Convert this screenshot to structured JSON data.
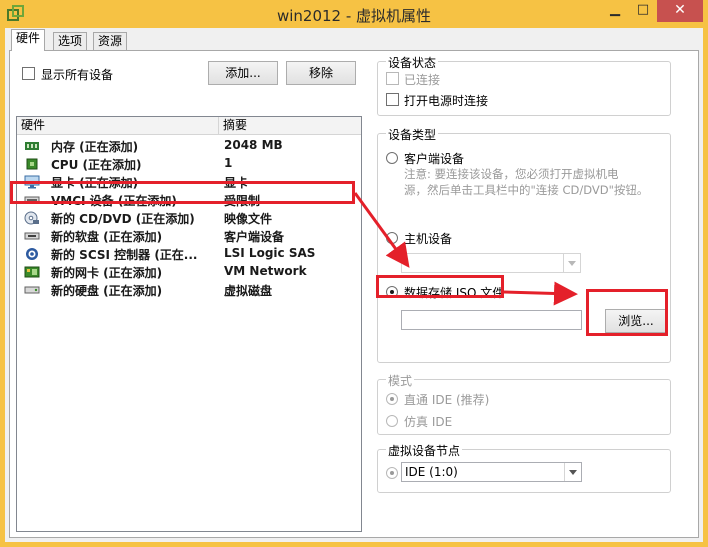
{
  "window": {
    "title": "win2012 - 虚拟机属性",
    "minimize_glyph": "▁",
    "maximize_glyph": "□",
    "close_glyph": "✕"
  },
  "tabs": [
    {
      "label": "硬件",
      "active": true
    },
    {
      "label": "选项",
      "active": false
    },
    {
      "label": "资源",
      "active": false
    }
  ],
  "hardware": {
    "show_all_label": "显示所有设备",
    "add_label": "添加...",
    "remove_label": "移除",
    "columns": [
      "硬件",
      "摘要"
    ],
    "rows": [
      {
        "name": "内存 (正在添加)",
        "summary": "2048 MB",
        "icon": "memory-icon"
      },
      {
        "name": "CPU (正在添加)",
        "summary": "1",
        "icon": "cpu-icon"
      },
      {
        "name": "显卡 (正在添加)",
        "summary": "显卡",
        "icon": "display-icon"
      },
      {
        "name": "VMCI 设备 (正在添加)",
        "summary": "受限制",
        "icon": "vmci-icon"
      },
      {
        "name": "新的 CD/DVD (正在添加)",
        "summary": "映像文件",
        "icon": "cd-dvd-icon"
      },
      {
        "name": "新的软盘 (正在添加)",
        "summary": "客户端设备",
        "icon": "floppy-icon"
      },
      {
        "name": "新的 SCSI 控制器 (正在...",
        "summary": "LSI Logic SAS",
        "icon": "scsi-icon"
      },
      {
        "name": "新的网卡 (正在添加)",
        "summary": "VM Network",
        "icon": "nic-icon"
      },
      {
        "name": "新的硬盘 (正在添加)",
        "summary": "虚拟磁盘",
        "icon": "disk-icon"
      }
    ]
  },
  "device_status": {
    "title": "设备状态",
    "connected_label": "已连接",
    "connect_on_power_label": "打开电源时连接"
  },
  "device_type": {
    "title": "设备类型",
    "client_device_label": "客户端设备",
    "client_note": "注意: 要连接该设备，您必须打开虚拟机电源，然后单击工具栏中的\"连接 CD/DVD\"按钮。",
    "client_note_line1": "注意: 要连接该设备，您必须打开虚拟机电",
    "client_note_line2": "源，然后单击工具栏中的\"连接 CD/DVD\"按钮。",
    "host_device_label": "主机设备",
    "datastore_iso_label": "数据存储 ISO 文件",
    "iso_path_value": "",
    "browse_label": "浏览..."
  },
  "mode": {
    "title": "模式",
    "passthrough_label": "直通 IDE (推荐)",
    "emulate_label": "仿真 IDE"
  },
  "virtual_node": {
    "title": "虚拟设备节点",
    "selected": "IDE (1:0)"
  },
  "colors": {
    "title_bar": "#f6c244",
    "close_button": "#c7514f",
    "annotation": "#e4202a"
  }
}
